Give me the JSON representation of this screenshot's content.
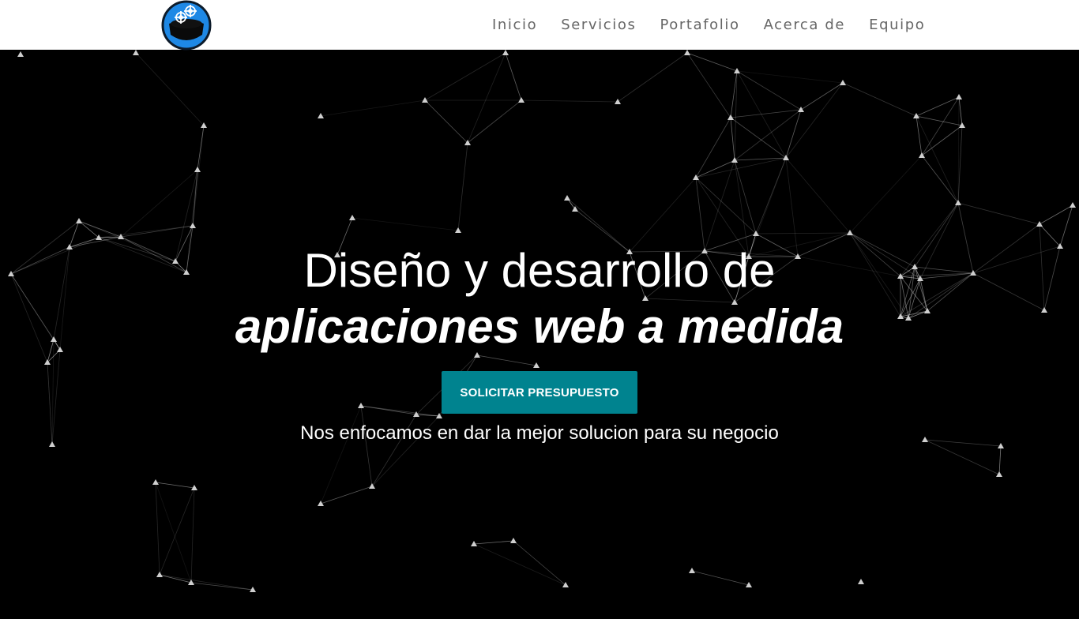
{
  "brand": {
    "logo_icon": "gears-helmet-logo",
    "accent": "#1e88e5"
  },
  "nav": {
    "items": [
      "Inicio",
      "Servicios",
      "Portafolio",
      "Acerca de",
      "Equipo"
    ]
  },
  "hero": {
    "title_line1": "Diseño y desarrollo de",
    "title_line2": "aplicaciones web a medida",
    "cta_label": "SOLICITAR PRESUPUESTO",
    "subtitle": "Nos enfocamos en dar la mejor solucion para su negocio",
    "background": "particle-network"
  },
  "colors": {
    "navbar_bg": "#ffffff",
    "hero_bg": "#000000",
    "cta_bg": "#00838f",
    "nav_text": "#666666"
  }
}
